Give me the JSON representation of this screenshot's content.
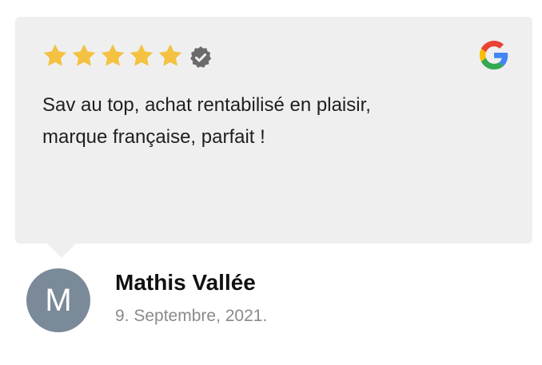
{
  "review": {
    "rating": 5,
    "rating_max": 5,
    "text_line1": "Sav au top, achat rentabilisé en plaisir,",
    "text_line2": "marque française, parfait !",
    "source_icon": "google-icon",
    "verified_icon": "verified-badge-icon"
  },
  "author": {
    "initial": "M",
    "name": "Mathis Vallée",
    "date": "9. Septembre, 2021."
  },
  "colors": {
    "card_background": "#efefef",
    "star": "#f4c141",
    "verified_badge": "#6b6b6b",
    "avatar_background": "#7a8a99",
    "date_text": "#8a8a8a"
  }
}
